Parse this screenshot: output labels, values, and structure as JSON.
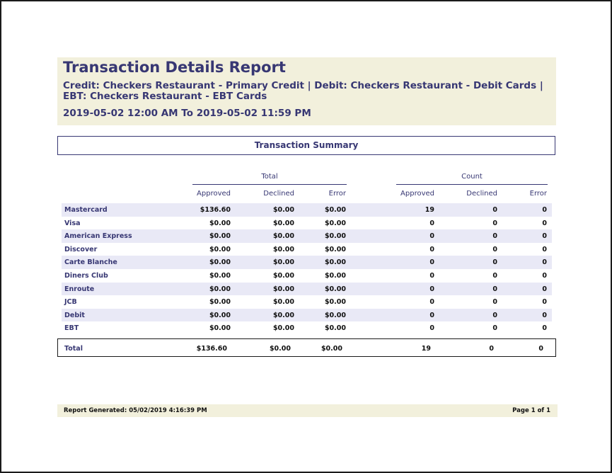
{
  "report": {
    "title": "Transaction Details Report",
    "subtitle": "Credit: Checkers Restaurant - Primary Credit | Debit: Checkers Restaurant - Debit Cards | EBT: Checkers Restaurant - EBT Cards",
    "date_range": "2019-05-02 12:00 AM To 2019-05-02 11:59 PM"
  },
  "summary": {
    "heading": "Transaction Summary",
    "groups": {
      "total": "Total",
      "count": "Count"
    },
    "columns": [
      "Approved",
      "Declined",
      "Error",
      "Approved",
      "Declined",
      "Error"
    ],
    "rows": [
      {
        "label": "Mastercard",
        "values": [
          "$136.60",
          "$0.00",
          "$0.00",
          "19",
          "0",
          "0"
        ]
      },
      {
        "label": "Visa",
        "values": [
          "$0.00",
          "$0.00",
          "$0.00",
          "0",
          "0",
          "0"
        ]
      },
      {
        "label": "American Express",
        "values": [
          "$0.00",
          "$0.00",
          "$0.00",
          "0",
          "0",
          "0"
        ]
      },
      {
        "label": "Discover",
        "values": [
          "$0.00",
          "$0.00",
          "$0.00",
          "0",
          "0",
          "0"
        ]
      },
      {
        "label": "Carte Blanche",
        "values": [
          "$0.00",
          "$0.00",
          "$0.00",
          "0",
          "0",
          "0"
        ]
      },
      {
        "label": "Diners Club",
        "values": [
          "$0.00",
          "$0.00",
          "$0.00",
          "0",
          "0",
          "0"
        ]
      },
      {
        "label": "Enroute",
        "values": [
          "$0.00",
          "$0.00",
          "$0.00",
          "0",
          "0",
          "0"
        ]
      },
      {
        "label": "JCB",
        "values": [
          "$0.00",
          "$0.00",
          "$0.00",
          "0",
          "0",
          "0"
        ]
      },
      {
        "label": "Debit",
        "values": [
          "$0.00",
          "$0.00",
          "$0.00",
          "0",
          "0",
          "0"
        ]
      },
      {
        "label": "EBT",
        "values": [
          "$0.00",
          "$0.00",
          "$0.00",
          "0",
          "0",
          "0"
        ]
      }
    ],
    "total": {
      "label": "Total",
      "values": [
        "$136.60",
        "$0.00",
        "$0.00",
        "19",
        "0",
        "0"
      ]
    }
  },
  "footer": {
    "generated": "Report Generated: 05/02/2019 4:16:39 PM",
    "page": "Page 1 of 1"
  },
  "colors": {
    "accent": "#373773",
    "header_bg": "#f2f0dc",
    "row_shade": "#e9e9f6"
  }
}
